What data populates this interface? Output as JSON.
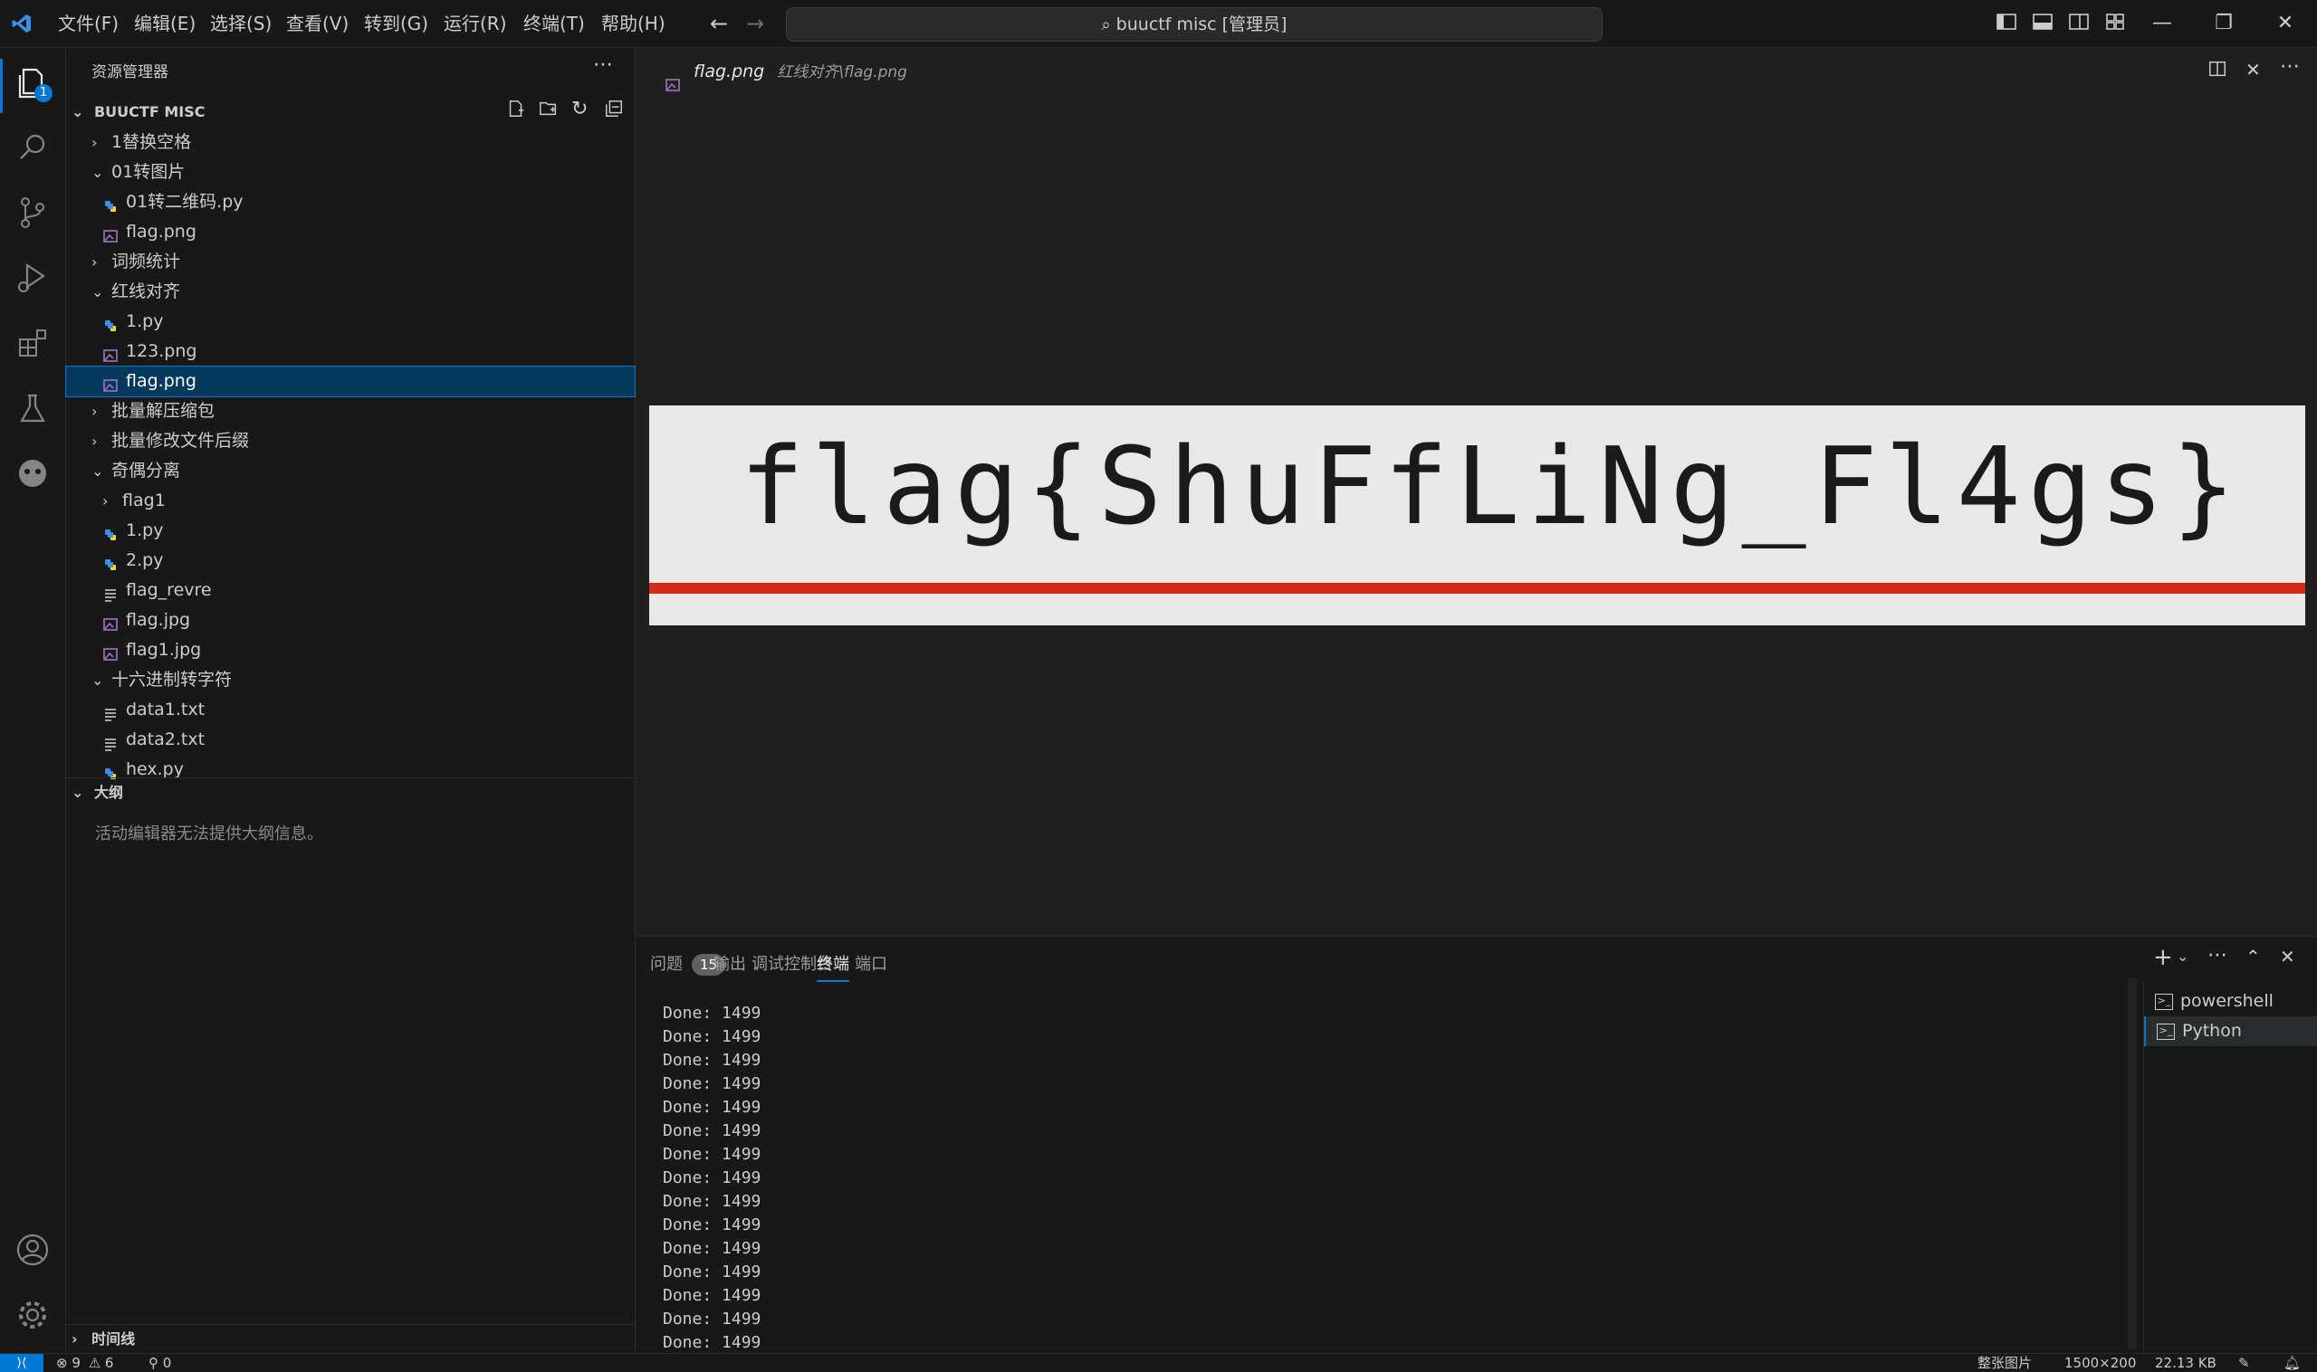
{
  "titlebar": {
    "menu": [
      "文件(F)",
      "编辑(E)",
      "选择(S)",
      "查看(V)",
      "转到(G)",
      "运行(R)",
      "终端(T)",
      "帮助(H)"
    ],
    "search": "buuctf misc [管理员]"
  },
  "activity": {
    "explorer_badge": "1"
  },
  "sidebar": {
    "title": "资源管理器",
    "root": "BUUCTF MISC",
    "tree": [
      {
        "label": "1替换空格",
        "type": "folder",
        "open": false,
        "depth": 0
      },
      {
        "label": "01转图片",
        "type": "folder",
        "open": true,
        "depth": 0
      },
      {
        "label": "01转二维码.py",
        "type": "py",
        "depth": 1
      },
      {
        "label": "flag.png",
        "type": "img",
        "depth": 1
      },
      {
        "label": "词频统计",
        "type": "folder",
        "open": false,
        "depth": 0
      },
      {
        "label": "红线对齐",
        "type": "folder",
        "open": true,
        "depth": 0
      },
      {
        "label": "1.py",
        "type": "py",
        "depth": 1
      },
      {
        "label": "123.png",
        "type": "img",
        "depth": 1
      },
      {
        "label": "flag.png",
        "type": "img",
        "depth": 1,
        "selected": true
      },
      {
        "label": "批量解压缩包",
        "type": "folder",
        "open": false,
        "depth": 0
      },
      {
        "label": "批量修改文件后缀",
        "type": "folder",
        "open": false,
        "depth": 0
      },
      {
        "label": "奇偶分离",
        "type": "folder",
        "open": true,
        "depth": 0
      },
      {
        "label": "flag1",
        "type": "folder",
        "open": false,
        "depth": 1
      },
      {
        "label": "1.py",
        "type": "py",
        "depth": 1
      },
      {
        "label": "2.py",
        "type": "py",
        "depth": 1
      },
      {
        "label": "flag_revre",
        "type": "txt",
        "depth": 1
      },
      {
        "label": "flag.jpg",
        "type": "img",
        "depth": 1
      },
      {
        "label": "flag1.jpg",
        "type": "img",
        "depth": 1
      },
      {
        "label": "十六进制转字符",
        "type": "folder",
        "open": true,
        "depth": 0
      },
      {
        "label": "data1.txt",
        "type": "txt",
        "depth": 1
      },
      {
        "label": "data2.txt",
        "type": "txt",
        "depth": 1
      },
      {
        "label": "hex.py",
        "type": "py",
        "depth": 1
      }
    ],
    "outline_title": "大纲",
    "outline_msg": "活动编辑器无法提供大纲信息。",
    "timeline_title": "时间线"
  },
  "editor": {
    "tab_name": "flag.png",
    "tab_path": "红线对齐\\flag.png",
    "image_text": "flag{ShuFfLiNg_Fl4gs}"
  },
  "panel": {
    "tabs": [
      "问题",
      "输出",
      "调试控制台",
      "终端",
      "端口"
    ],
    "problems_count": "15",
    "active_tab": "终端",
    "terminal_line": "Done: 1499",
    "terminal_line_count": 15,
    "terminals": [
      "powershell",
      "Python"
    ]
  },
  "statusbar": {
    "errors": "9",
    "warnings": "6",
    "ports": "0",
    "image_kind": "整张图片",
    "dimensions": "1500×200",
    "size": "22.13 KB"
  },
  "colors": {
    "accent": "#0078d4",
    "py_icon": "#3b8eea",
    "img_icon": "#a074c4",
    "flag_red": "#d42a1a"
  }
}
